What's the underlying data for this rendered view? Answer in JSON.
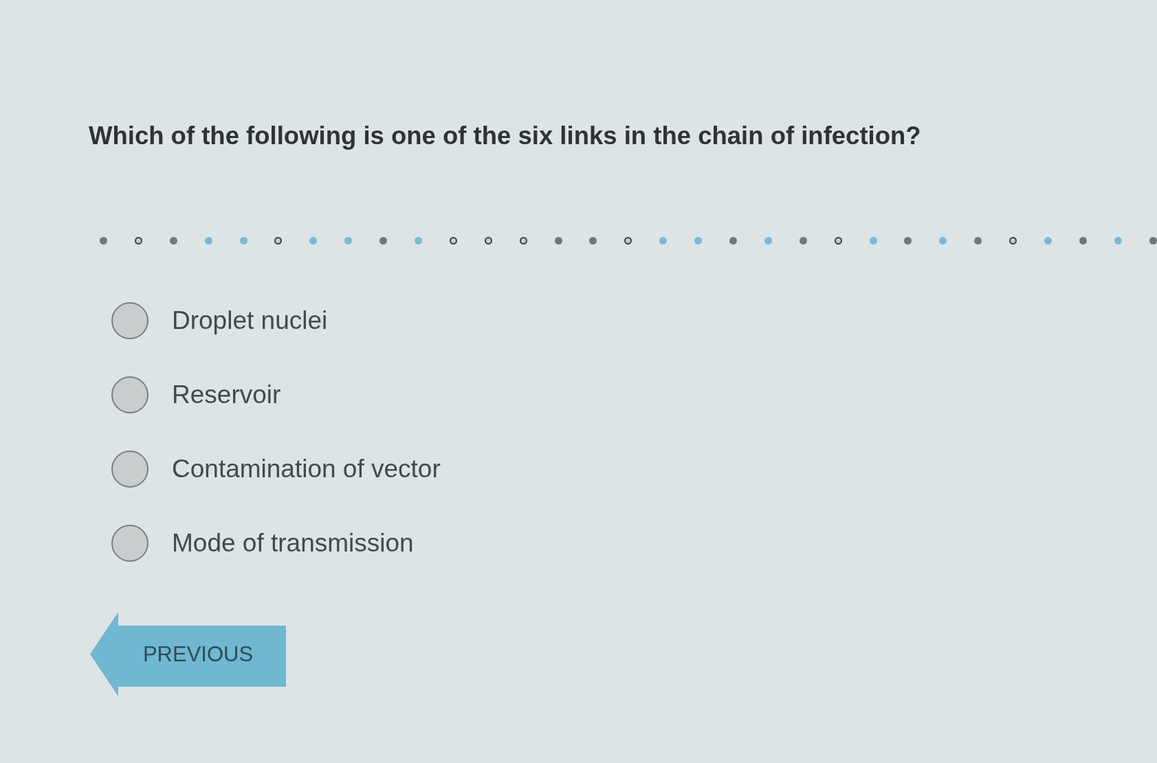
{
  "question": {
    "text": "Which of the following is one of the six links in the chain of infection?"
  },
  "progress": [
    {
      "kind": "filled"
    },
    {
      "kind": "hollow"
    },
    {
      "kind": "filled"
    },
    {
      "kind": "highlighted"
    },
    {
      "kind": "highlighted"
    },
    {
      "kind": "hollow"
    },
    {
      "kind": "highlighted"
    },
    {
      "kind": "highlighted"
    },
    {
      "kind": "filled"
    },
    {
      "kind": "highlighted"
    },
    {
      "kind": "hollow"
    },
    {
      "kind": "hollow"
    },
    {
      "kind": "hollow"
    },
    {
      "kind": "filled"
    },
    {
      "kind": "filled"
    },
    {
      "kind": "hollow"
    },
    {
      "kind": "highlighted"
    },
    {
      "kind": "highlighted"
    },
    {
      "kind": "filled"
    },
    {
      "kind": "highlighted"
    },
    {
      "kind": "filled"
    },
    {
      "kind": "hollow"
    },
    {
      "kind": "highlighted"
    },
    {
      "kind": "filled"
    },
    {
      "kind": "highlighted"
    },
    {
      "kind": "filled"
    },
    {
      "kind": "hollow"
    },
    {
      "kind": "highlighted"
    },
    {
      "kind": "filled"
    },
    {
      "kind": "highlighted"
    },
    {
      "kind": "filled"
    }
  ],
  "options": [
    {
      "label": "Droplet nuclei",
      "selected": false
    },
    {
      "label": "Reservoir",
      "selected": false
    },
    {
      "label": "Contamination of vector",
      "selected": false
    },
    {
      "label": "Mode of transmission",
      "selected": false
    }
  ],
  "previous_button": {
    "label": "PREVIOUS"
  }
}
